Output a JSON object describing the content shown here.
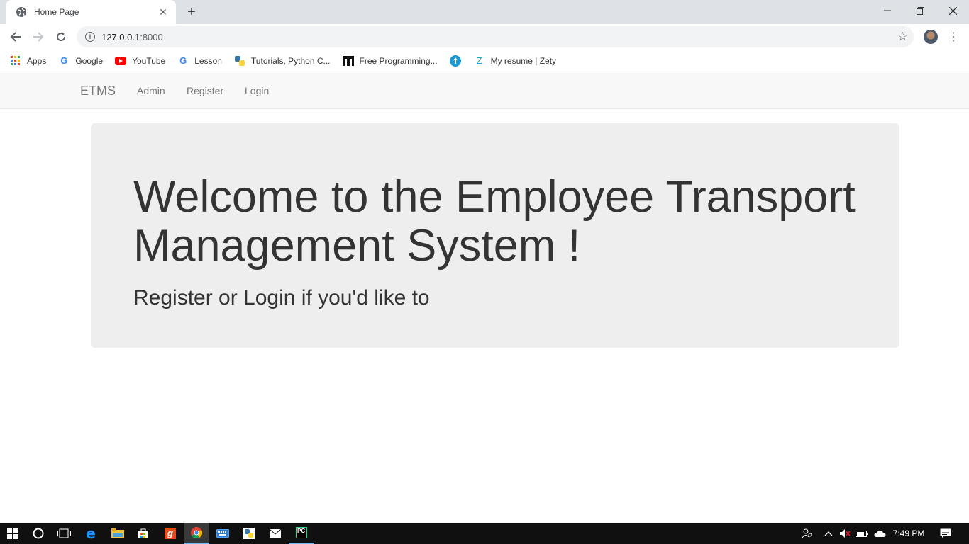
{
  "browser": {
    "tab_title": "Home Page",
    "new_tab_symbol": "+",
    "url_host": "127.0.0.1",
    "url_port": ":8000",
    "bookmarks": [
      {
        "label": "Apps",
        "icon": "apps-grid-icon"
      },
      {
        "label": "Google",
        "icon": "google-icon"
      },
      {
        "label": "YouTube",
        "icon": "youtube-icon"
      },
      {
        "label": "Lesson",
        "icon": "google-icon"
      },
      {
        "label": "Tutorials, Python C...",
        "icon": "python-icon"
      },
      {
        "label": "Free Programming...",
        "icon": "book-icon"
      },
      {
        "label": "",
        "icon": "circle-arrow-icon"
      },
      {
        "label": "My resume | Zety",
        "icon": "zety-icon"
      }
    ]
  },
  "navbar": {
    "brand": "ETMS",
    "links": [
      "Admin",
      "Register",
      "Login"
    ]
  },
  "jumbotron": {
    "title": "Welcome to the Employee Transport Management System !",
    "lead": "Register or Login if you'd like to"
  },
  "taskbar": {
    "clock": "7:49 PM"
  },
  "colors": {
    "navbar_bg": "#f8f8f8",
    "jumbotron_bg": "#eeeeee",
    "text": "#333333",
    "navlink": "#777777"
  }
}
